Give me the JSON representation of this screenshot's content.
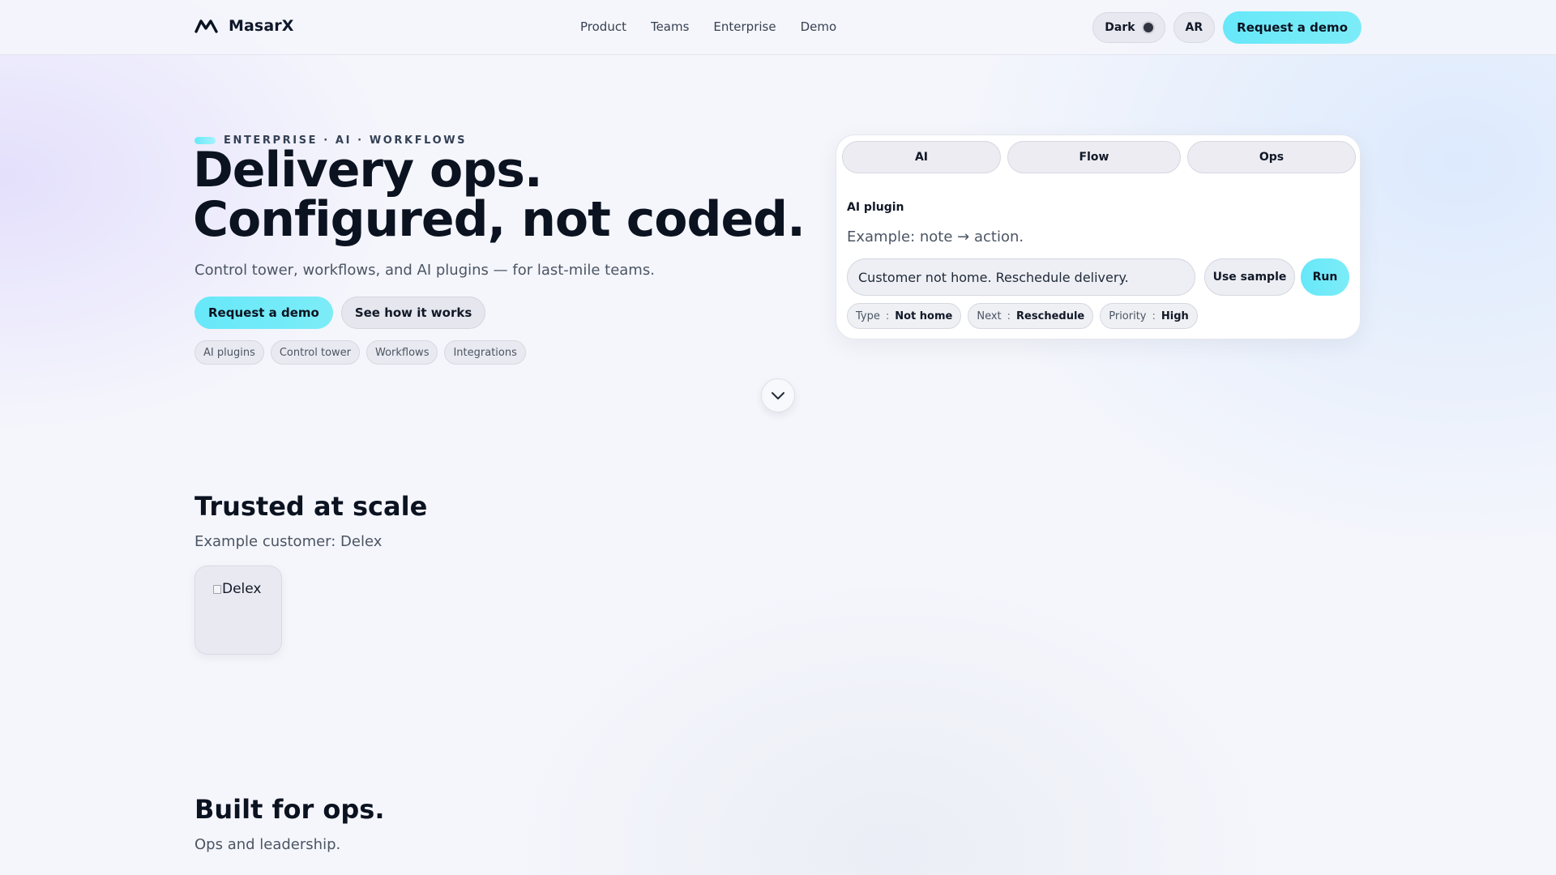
{
  "nav": {
    "brand": "MasarX",
    "links": [
      "Product",
      "Teams",
      "Enterprise",
      "Demo"
    ],
    "theme_toggle": "Dark",
    "lang_toggle": "AR",
    "cta": "Request a demo"
  },
  "hero": {
    "eyebrow": "ENTERPRISE · AI · WORKFLOWS",
    "title_line1": "Delivery ops.",
    "title_line2": "Configured, not coded.",
    "subtitle": "Control tower, workflows, and AI plugins — for last-mile teams.",
    "primary_button": "Request a demo",
    "secondary_button": "See how it works",
    "tags": [
      "AI plugins",
      "Control tower",
      "Workflows",
      "Integrations"
    ]
  },
  "ai_card": {
    "tabs": [
      "AI",
      "Flow",
      "Ops"
    ],
    "label": "AI plugin",
    "example": "Example: note → action.",
    "input_value": "Customer not home. Reschedule delivery.",
    "sample_button": "Use sample",
    "run_button": "Run",
    "results": [
      {
        "key": "Type",
        "value": "Not home"
      },
      {
        "key": "Next",
        "value": "Reschedule"
      },
      {
        "key": "Priority",
        "value": "High"
      }
    ]
  },
  "trusted": {
    "title": "Trusted at scale",
    "subtitle": "Example customer: Delex",
    "logo_alt": "Delex"
  },
  "built": {
    "title": "Built for ops.",
    "subtitle": "Ops and leadership."
  },
  "colors": {
    "accent": "#67e8f9",
    "background": "#f5f6fc",
    "text": "#0b1220"
  }
}
